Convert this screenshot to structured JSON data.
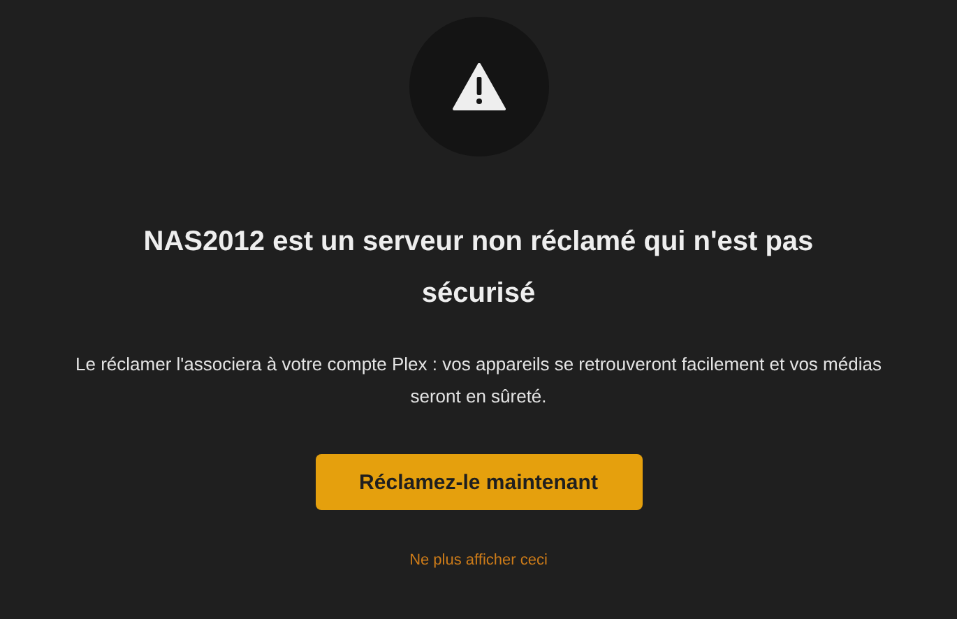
{
  "title": "NAS2012 est un serveur non réclamé qui n'est pas sécurisé",
  "message": "Le réclamer l'associera à votre compte Plex : vos appareils se retrouveront facilement et vos médias seront en sûreté.",
  "primary_button": "Réclamez-le maintenant",
  "dismiss_link": "Ne plus afficher ceci"
}
